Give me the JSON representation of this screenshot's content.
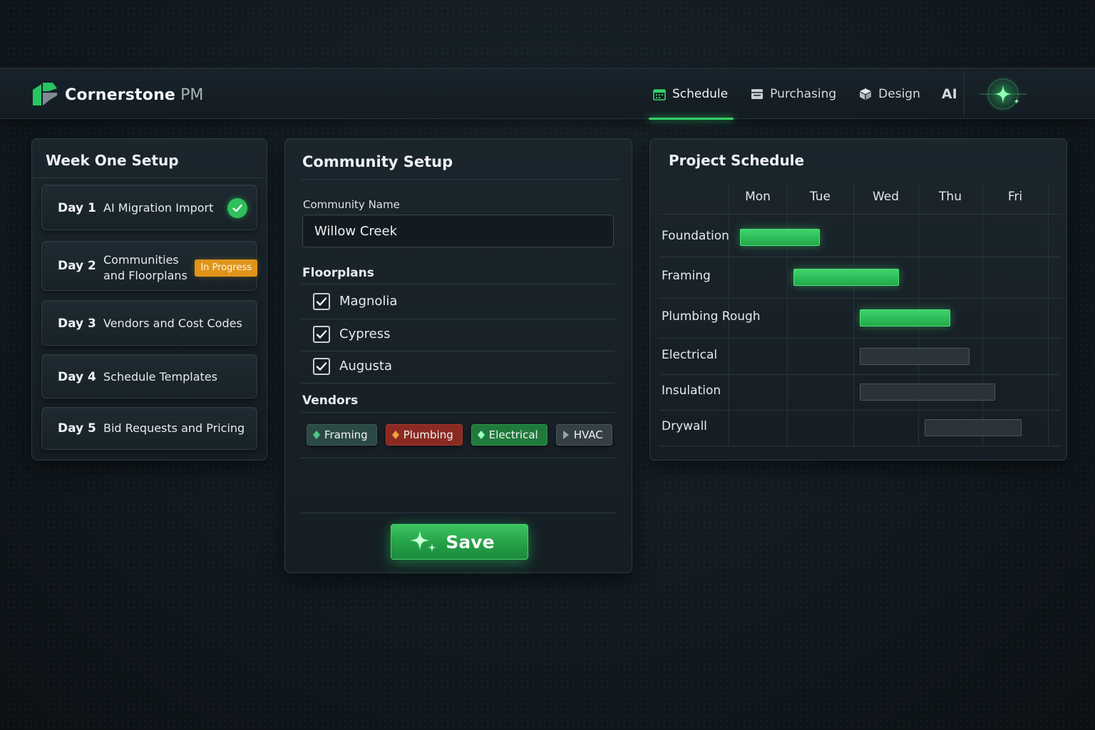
{
  "app": {
    "brand_name": "Cornerstone",
    "brand_suffix": "PM"
  },
  "nav": {
    "items": [
      {
        "label": "Schedule",
        "icon": "calendar-icon",
        "active": true
      },
      {
        "label": "Purchasing",
        "icon": "cart-icon",
        "active": false
      },
      {
        "label": "Design",
        "icon": "cube-icon",
        "active": false
      }
    ],
    "ai_label": "AI",
    "assistant_icon": "sparkle-icon"
  },
  "week_setup": {
    "title": "Week One Setup",
    "days": [
      {
        "day": "Day 1",
        "label": "AI Migration Import",
        "status": "complete"
      },
      {
        "day": "Day 2",
        "label_lines": [
          "Communities",
          "and Floorplans"
        ],
        "status_badge": "In Progress"
      },
      {
        "day": "Day 3",
        "label": "Vendors and Cost Codes"
      },
      {
        "day": "Day 4",
        "label": "Schedule Templates"
      },
      {
        "day": "Day 5",
        "label": "Bid Requests and Pricing"
      }
    ]
  },
  "community_setup": {
    "title": "Community Setup",
    "community_name_label": "Community Name",
    "community_name_value": "Willow Creek",
    "floorplans_label": "Floorplans",
    "floorplans": [
      {
        "name": "Magnolia",
        "checked": true
      },
      {
        "name": "Cypress",
        "checked": true
      },
      {
        "name": "Augusta",
        "checked": true
      }
    ],
    "vendors_label": "Vendors",
    "vendors": [
      {
        "name": "Framing",
        "color": "#2c4a45"
      },
      {
        "name": "Plumbing",
        "color": "#8a2a22"
      },
      {
        "name": "Electrical",
        "color": "#1f7a3b"
      },
      {
        "name": "HVAC",
        "color": "#353f46"
      }
    ],
    "save_label": "Save"
  },
  "project_schedule": {
    "title": "Project Schedule",
    "days": [
      "Mon",
      "Tue",
      "Wed",
      "Thu",
      "Fri"
    ],
    "tasks": [
      {
        "name": "Foundation",
        "start": 0.2,
        "end": 1.5,
        "status": "done"
      },
      {
        "name": "Framing",
        "start": 1.1,
        "end": 2.7,
        "status": "done"
      },
      {
        "name": "Plumbing Rough",
        "start": 2.1,
        "end": 3.5,
        "status": "done"
      },
      {
        "name": "Electrical",
        "start": 2.1,
        "end": 3.8,
        "status": "pending"
      },
      {
        "name": "Insulation",
        "start": 2.1,
        "end": 4.2,
        "status": "pending"
      },
      {
        "name": "Drywall",
        "start": 3.1,
        "end": 4.6,
        "status": "pending"
      }
    ]
  },
  "colors": {
    "accent_green": "#35d36a",
    "in_progress": "#e0951a"
  }
}
